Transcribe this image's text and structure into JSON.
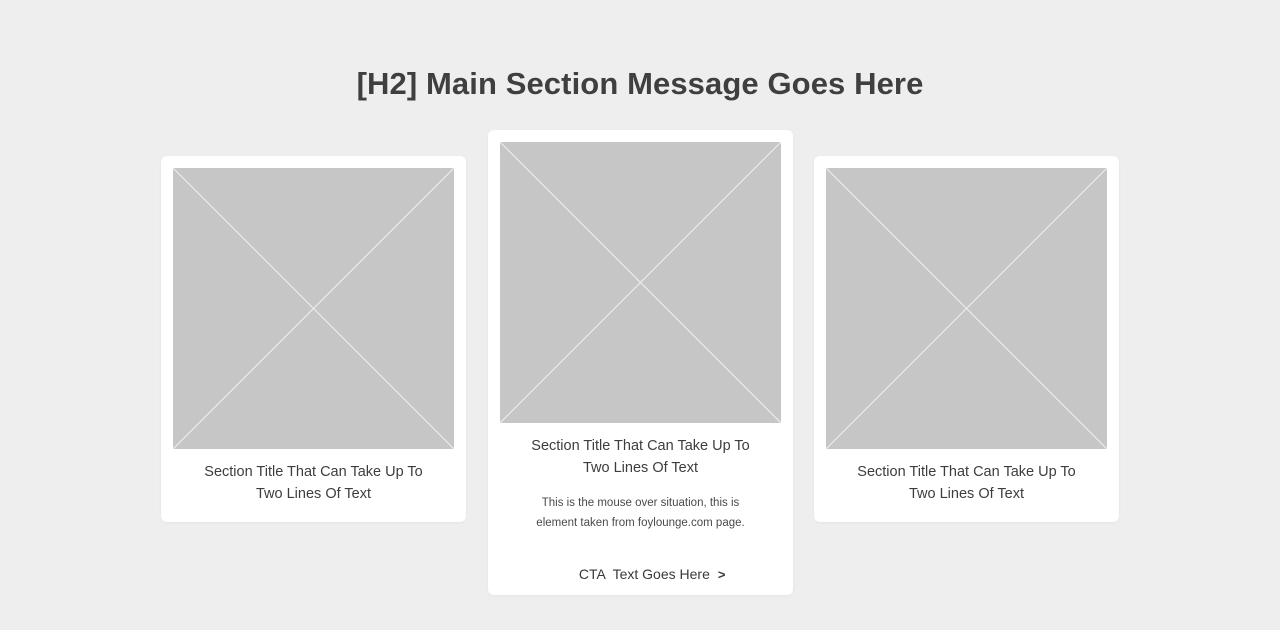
{
  "section": {
    "heading": "[H2] Main Section Message Goes Here"
  },
  "cards": [
    {
      "title_line1": "Section Title That Can Take Up To",
      "title_line2": "Two Lines Of Text"
    },
    {
      "title_line1": "Section Title That Can Take Up To",
      "title_line2": "Two Lines Of Text",
      "desc_line1": "This is the mouse over situation, this is",
      "desc_line2": "element taken from foylounge.com  page.",
      "cta_label": "CTA  Text Goes Here",
      "cta_icon": "chevron-right-icon"
    },
    {
      "title_line1": "Section Title That Can Take Up To",
      "title_line2": "Two Lines Of Text"
    }
  ],
  "colors": {
    "background": "#eeeeee",
    "card": "#ffffff",
    "placeholder_fill": "#c6c6c6",
    "placeholder_lines": "#ebebeb",
    "text": "#3d3d3d"
  }
}
